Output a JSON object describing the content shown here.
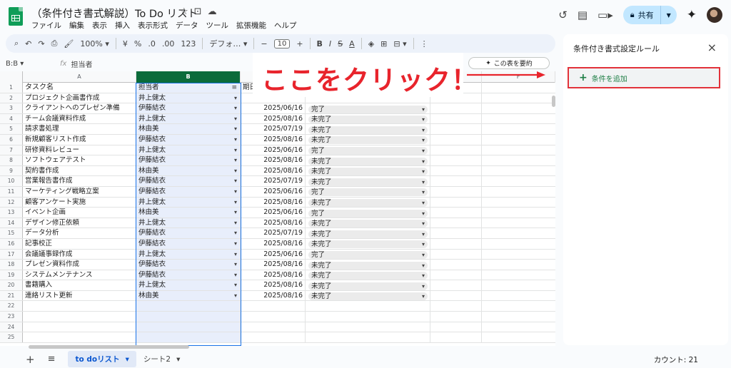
{
  "header": {
    "title": "（条件付き書式解説）To Do リスト",
    "title_icons": [
      "star-icon",
      "folder-move-icon",
      "cloud-icon"
    ],
    "menu": [
      "ファイル",
      "編集",
      "表示",
      "挿入",
      "表示形式",
      "データ",
      "ツール",
      "拡張機能",
      "ヘルプ"
    ],
    "share_label": "共有"
  },
  "toolbar": {
    "zoom": "100%",
    "currency": "¥",
    "percent": "%",
    "dec_decrease": ".0",
    "dec_increase": ".00",
    "number_format": "123",
    "font": "デフォ…",
    "font_size": "10",
    "bold": "B"
  },
  "formula_bar": {
    "namebox": "B:B",
    "fx": "fx",
    "content": "担当者"
  },
  "summarize_label": "この表を要約",
  "columns": [
    "A",
    "B",
    "C",
    "D",
    "E",
    "F"
  ],
  "headers": {
    "a": "タスク名",
    "b": "担当者",
    "c": "期日"
  },
  "rows": [
    {
      "n": "2",
      "task": "プロジェクト企画書作成",
      "person": "井上健太",
      "date": "",
      "status": ""
    },
    {
      "n": "3",
      "task": "クライアントへのプレゼン準備",
      "person": "伊藤結衣",
      "date": "2025/06/16",
      "status": "完了"
    },
    {
      "n": "4",
      "task": "チーム会議資料作成",
      "person": "井上健太",
      "date": "2025/08/16",
      "status": "未完了"
    },
    {
      "n": "5",
      "task": "請求書処理",
      "person": "林由美",
      "date": "2025/07/19",
      "status": "未完了"
    },
    {
      "n": "6",
      "task": "新規顧客リスト作成",
      "person": "伊藤結衣",
      "date": "2025/08/16",
      "status": "未完了"
    },
    {
      "n": "7",
      "task": "研修資料レビュー",
      "person": "井上健太",
      "date": "2025/06/16",
      "status": "完了"
    },
    {
      "n": "8",
      "task": "ソフトウェアテスト",
      "person": "伊藤結衣",
      "date": "2025/08/16",
      "status": "未完了"
    },
    {
      "n": "9",
      "task": "契約書作成",
      "person": "林由美",
      "date": "2025/08/16",
      "status": "未完了"
    },
    {
      "n": "10",
      "task": "営業報告書作成",
      "person": "伊藤結衣",
      "date": "2025/07/19",
      "status": "未完了"
    },
    {
      "n": "11",
      "task": "マーケティング戦略立案",
      "person": "伊藤結衣",
      "date": "2025/06/16",
      "status": "完了"
    },
    {
      "n": "12",
      "task": "顧客アンケート実施",
      "person": "井上健太",
      "date": "2025/08/16",
      "status": "未完了"
    },
    {
      "n": "13",
      "task": "イベント企画",
      "person": "林由美",
      "date": "2025/06/16",
      "status": "完了"
    },
    {
      "n": "14",
      "task": "デザイン修正依頼",
      "person": "井上健太",
      "date": "2025/08/16",
      "status": "未完了"
    },
    {
      "n": "15",
      "task": "データ分析",
      "person": "伊藤結衣",
      "date": "2025/07/19",
      "status": "未完了"
    },
    {
      "n": "16",
      "task": "記事校正",
      "person": "伊藤結衣",
      "date": "2025/08/16",
      "status": "未完了"
    },
    {
      "n": "17",
      "task": "会議議事録作成",
      "person": "井上健太",
      "date": "2025/06/16",
      "status": "完了"
    },
    {
      "n": "18",
      "task": "プレゼン資料作成",
      "person": "伊藤結衣",
      "date": "2025/08/16",
      "status": "未完了"
    },
    {
      "n": "19",
      "task": "システムメンテナンス",
      "person": "伊藤結衣",
      "date": "2025/08/16",
      "status": "未完了"
    },
    {
      "n": "20",
      "task": "書籍購入",
      "person": "井上健太",
      "date": "2025/08/16",
      "status": "未完了"
    },
    {
      "n": "21",
      "task": "連絡リスト更新",
      "person": "林由美",
      "date": "2025/08/16",
      "status": "未完了"
    }
  ],
  "empty_rows": [
    "22",
    "23",
    "24",
    "25"
  ],
  "callout_text": "ここをクリック！",
  "panel": {
    "title": "条件付き書式設定ルール",
    "add_rule": "条件を追加"
  },
  "bottom": {
    "active_tab": "to doリスト",
    "tab2": "シート2",
    "count": "カウント: 21"
  },
  "colors": {
    "accent_red": "#e8242c",
    "selected_column": "#0b6b3a",
    "add_rule_text": "#1e7e45"
  }
}
